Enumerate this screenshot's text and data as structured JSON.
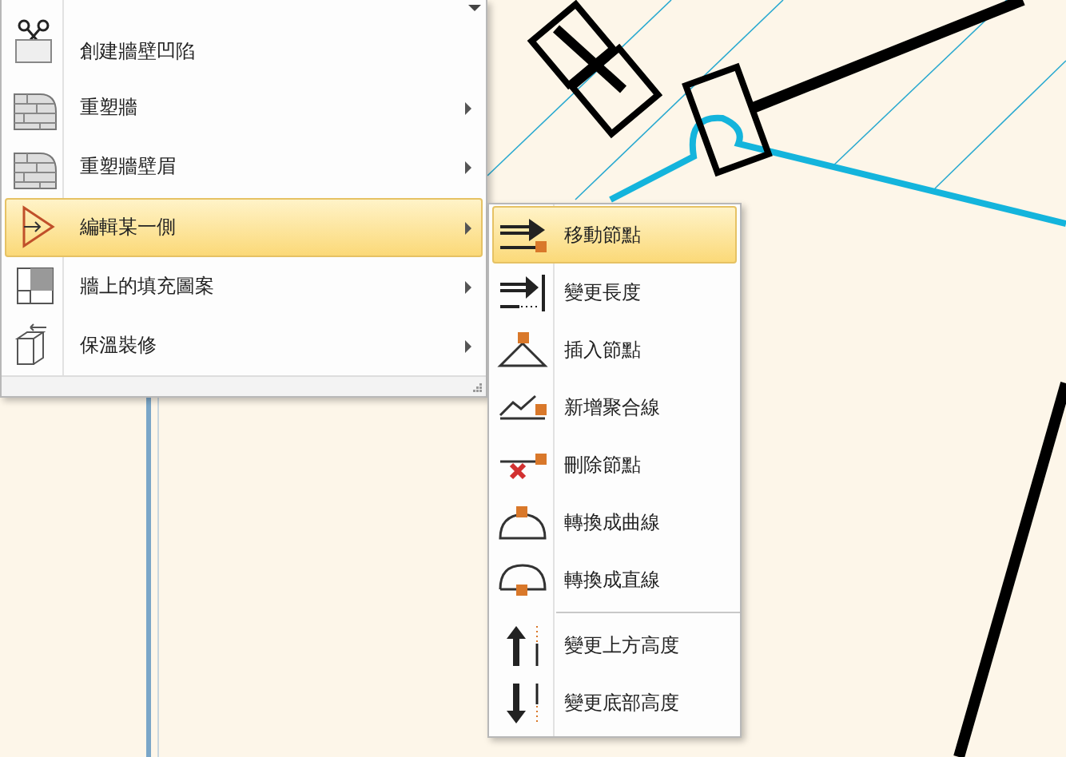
{
  "menu": {
    "items": [
      {
        "label": "創建牆壁凹陷",
        "kind": "cut",
        "has_submenu": false,
        "selected": false
      },
      {
        "label": "重塑牆",
        "kind": "wall",
        "has_submenu": true,
        "selected": false
      },
      {
        "label": "重塑牆壁眉",
        "kind": "wall",
        "has_submenu": true,
        "selected": false
      },
      {
        "label": "編輯某一側",
        "kind": "edge",
        "has_submenu": true,
        "selected": true
      },
      {
        "label": "牆上的填充圖案",
        "kind": "fill",
        "has_submenu": true,
        "selected": false
      },
      {
        "label": "保溫裝修",
        "kind": "cube",
        "has_submenu": true,
        "selected": false
      }
    ]
  },
  "submenu": {
    "items": [
      {
        "label": "移動節點",
        "kind": "move",
        "selected": true,
        "separator_before": false
      },
      {
        "label": "變更長度",
        "kind": "length",
        "selected": false,
        "separator_before": false
      },
      {
        "label": "插入節點",
        "kind": "insert",
        "selected": false,
        "separator_before": false
      },
      {
        "label": "新增聚合線",
        "kind": "poly",
        "selected": false,
        "separator_before": false
      },
      {
        "label": "刪除節點",
        "kind": "delete",
        "selected": false,
        "separator_before": false
      },
      {
        "label": "轉換成曲線",
        "kind": "curve",
        "selected": false,
        "separator_before": false
      },
      {
        "label": "轉換成直線",
        "kind": "straight",
        "selected": false,
        "separator_before": false
      },
      {
        "label": "變更上方高度",
        "kind": "up",
        "selected": false,
        "separator_before": true
      },
      {
        "label": "變更底部高度",
        "kind": "down",
        "selected": false,
        "separator_before": false
      }
    ]
  }
}
